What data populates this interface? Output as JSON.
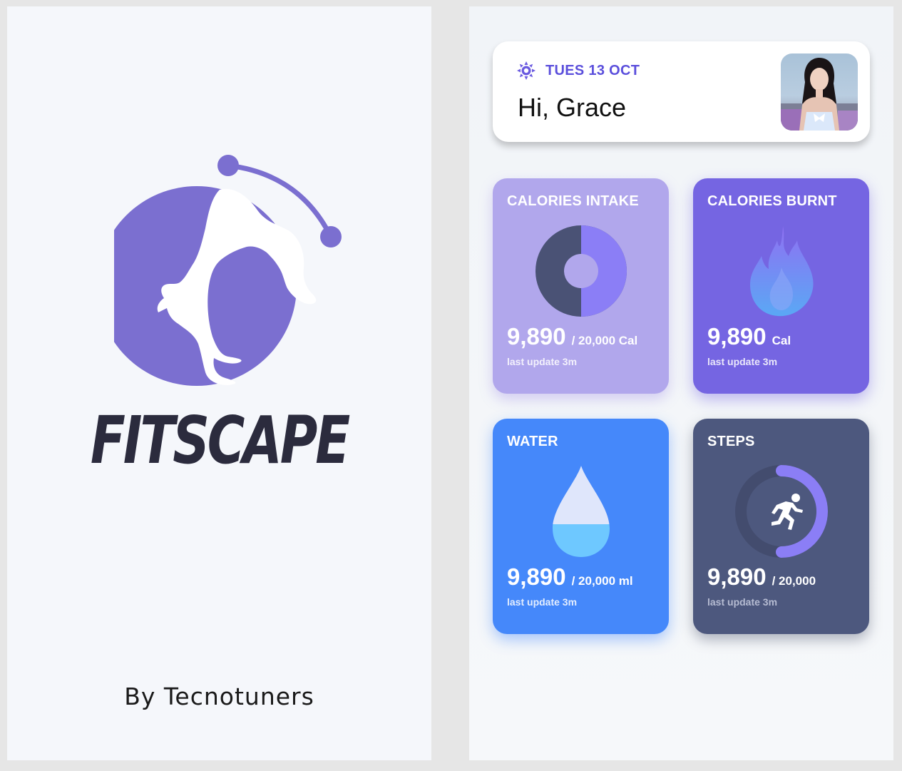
{
  "splash": {
    "brand_name": "FITSCAPE",
    "byline": "By Tecnotuners",
    "logo_color": "#7b6fd0"
  },
  "dashboard": {
    "date": "TUES 13 OCT",
    "greeting": "Hi, Grace",
    "cards": [
      {
        "id": "calories-intake",
        "title": "CALORIES INTAKE",
        "value": "9,890",
        "unit": "/ 20,000 Cal",
        "update": "last update 3m",
        "icon": "donut-chart-icon",
        "progress": 0.5,
        "color": "#b1a7ec"
      },
      {
        "id": "calories-burnt",
        "title": "CALORIES BURNT",
        "value": "9,890",
        "unit": "Cal",
        "update": "last update 3m",
        "icon": "flame-icon",
        "color": "#7565e2"
      },
      {
        "id": "water",
        "title": "WATER",
        "value": "9,890",
        "unit": "/ 20,000 ml",
        "update": "last update 3m",
        "icon": "water-drop-icon",
        "color": "#4588fa"
      },
      {
        "id": "steps",
        "title": "STEPS",
        "value": "9,890",
        "unit": "/ 20,000",
        "update": "last update 3m",
        "icon": "runner-icon",
        "progress": 0.5,
        "color": "#4d587e"
      }
    ]
  }
}
